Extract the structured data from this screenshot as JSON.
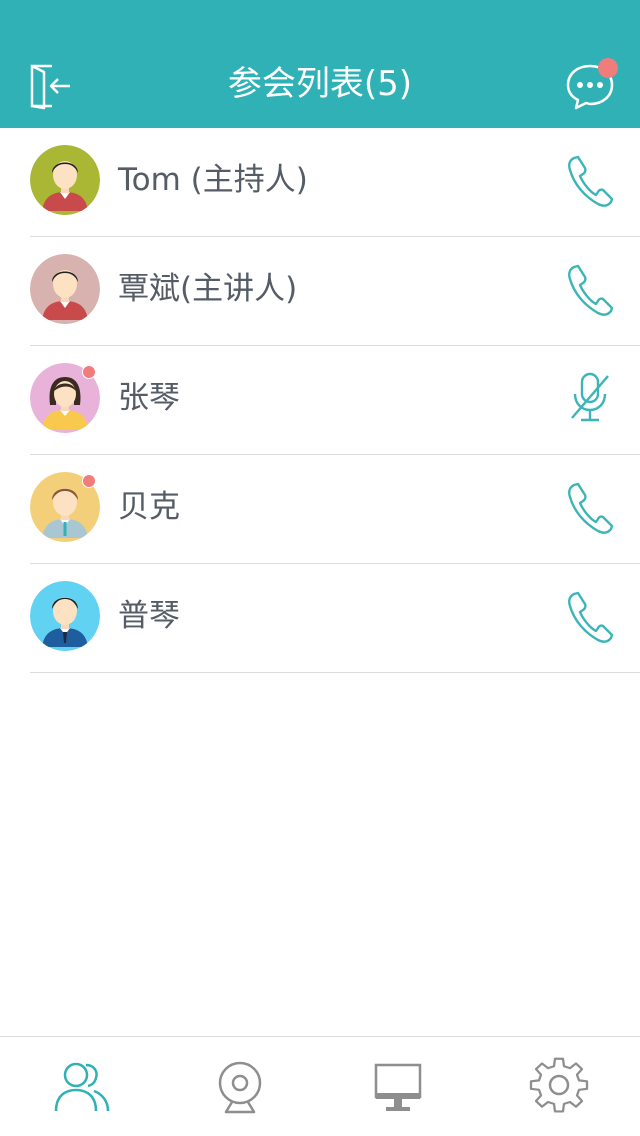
{
  "header": {
    "title": "参会列表(5)",
    "exit_icon": "exit-icon",
    "chat_icon": "chat-bubble-icon",
    "chat_has_notification": true
  },
  "participants": [
    {
      "name": "Tom (主持人)",
      "avatar": "male-avatar-green",
      "avatar_bg": "#a9b734",
      "status_dot": false,
      "action_icon": "phone-icon"
    },
    {
      "name": "覃斌(主讲人)",
      "avatar": "male-avatar-pink",
      "avatar_bg": "#d7b2ae",
      "status_dot": false,
      "action_icon": "phone-icon"
    },
    {
      "name": "张琴",
      "avatar": "female-avatar-pink",
      "avatar_bg": "#e9b3d9",
      "status_dot": true,
      "action_icon": "mic-muted-icon"
    },
    {
      "name": "贝克",
      "avatar": "male-avatar-yellow",
      "avatar_bg": "#f4cf79",
      "status_dot": true,
      "action_icon": "phone-icon"
    },
    {
      "name": "普琴",
      "avatar": "male-avatar-blue",
      "avatar_bg": "#62d2f3",
      "status_dot": false,
      "action_icon": "phone-icon"
    }
  ],
  "tabs": [
    {
      "icon": "participants-icon",
      "active": true
    },
    {
      "icon": "webcam-icon",
      "active": false
    },
    {
      "icon": "screen-share-icon",
      "active": false
    },
    {
      "icon": "settings-gear-icon",
      "active": false
    }
  ],
  "colors": {
    "accent": "#2fb1b6",
    "notification": "#f07c7c",
    "text": "#555c66",
    "icon_inactive": "#8e8e8e"
  }
}
